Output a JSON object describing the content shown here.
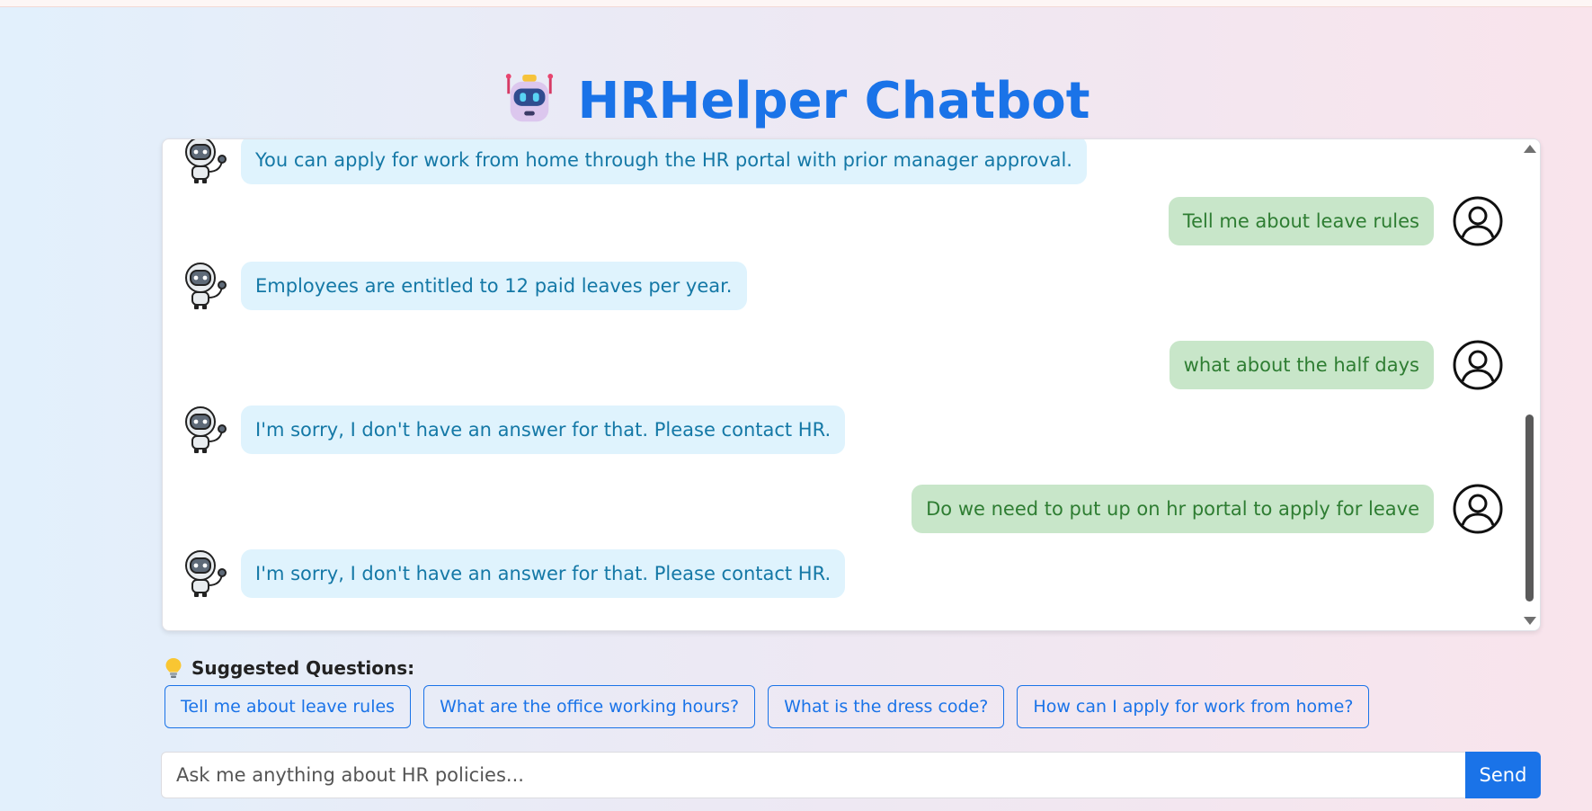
{
  "header": {
    "title": "HRHelper Chatbot",
    "logo_icon": "robot-head-icon"
  },
  "messages": [
    {
      "sender": "bot",
      "text": "You can apply for work from home through the HR portal with prior manager approval."
    },
    {
      "sender": "user",
      "text": "Tell me about leave rules"
    },
    {
      "sender": "bot",
      "text": "Employees are entitled to 12 paid leaves per year."
    },
    {
      "sender": "user",
      "text": "what about the half days"
    },
    {
      "sender": "bot",
      "text": "I'm sorry, I don't have an answer for that. Please contact HR."
    },
    {
      "sender": "user",
      "text": "Do we need to put up on hr portal to apply for leave"
    },
    {
      "sender": "bot",
      "text": "I'm sorry, I don't have an answer for that. Please contact HR."
    }
  ],
  "suggestions": {
    "title": "Suggested Questions:",
    "icon": "lightbulb-icon",
    "items": [
      "Tell me about leave rules",
      "What are the office working hours?",
      "What is the dress code?",
      "How can I apply for work from home?"
    ]
  },
  "input": {
    "placeholder": "Ask me anything about HR policies...",
    "value": "",
    "send_label": "Send"
  },
  "colors": {
    "accent": "#1a73e8",
    "bot_bubble": "#dff3fd",
    "bot_text": "#1478a6",
    "user_bubble": "#c8e6c9",
    "user_text": "#2e7d32"
  }
}
